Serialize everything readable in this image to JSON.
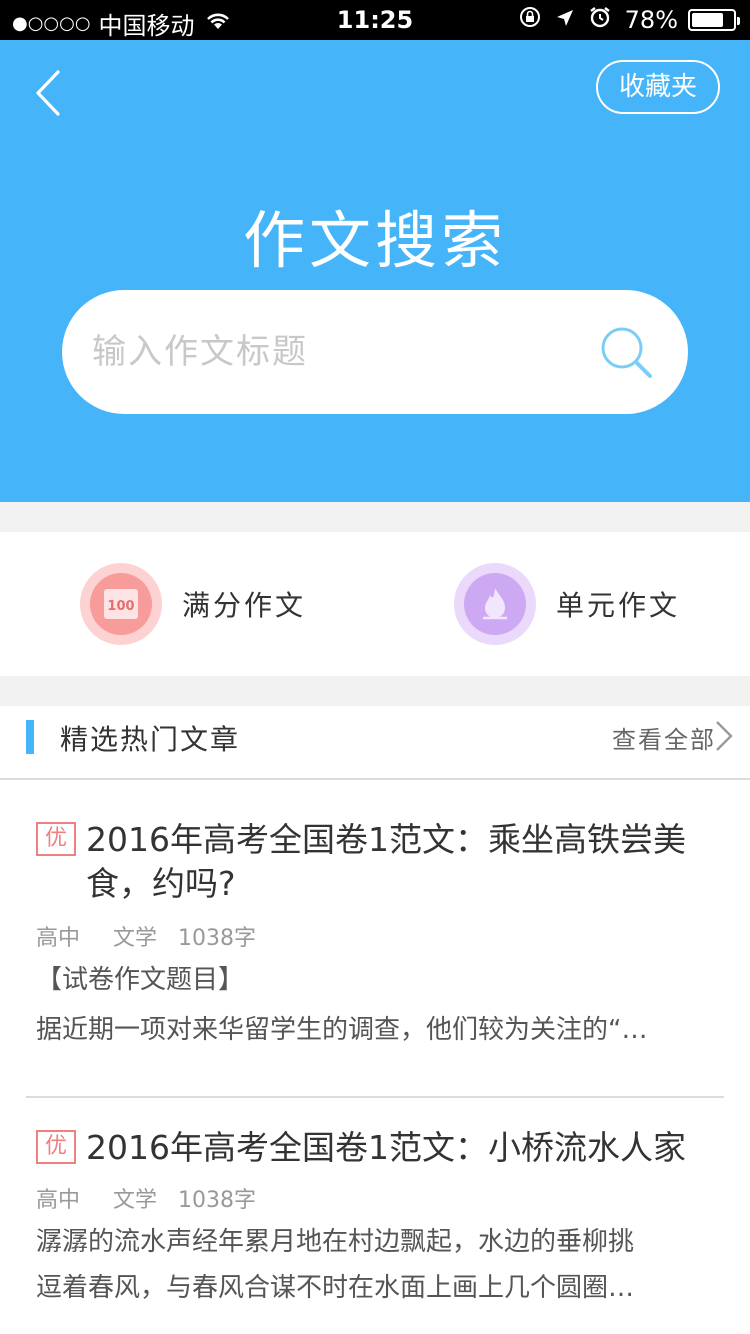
{
  "status_bar": {
    "signal_dots": "●○○○○",
    "carrier": "中国移动",
    "time": "11:25",
    "battery": "78%",
    "battery_level": 0.78,
    "wifi_icon": "wifi-icon",
    "lock_icon": "rotation-lock-icon",
    "location_icon": "location-arrow-icon",
    "alarm_icon": "alarm-icon"
  },
  "header": {
    "favorites_label": "收藏夹",
    "title": "作文搜索",
    "search_placeholder": "输入作文标题",
    "background_color": "#46b4f8"
  },
  "quick_links": [
    {
      "label": "满分作文",
      "icon": "score-100-icon",
      "color": "#f48e8e"
    },
    {
      "label": "单元作文",
      "icon": "flame-icon",
      "color": "#c79ef0"
    }
  ],
  "section": {
    "title": "精选热门文章",
    "more_label": "查看全部"
  },
  "articles": [
    {
      "tag": "优",
      "title": "2016年高考全国卷1范文：乘坐高铁尝美食，约吗?",
      "level": "高中",
      "category": "文学",
      "word_count": "1038字",
      "excerpt_line1": "【试卷作文题目】",
      "excerpt_line2": "据近期一项对来华留学生的调查，他们较为关注的“…"
    },
    {
      "tag": "优",
      "title": "2016年高考全国卷1范文：小桥流水人家",
      "level": "高中",
      "category": "文学",
      "word_count": "1038字",
      "excerpt_line1": "潺潺的流水声经年累月地在村边飘起，水边的垂柳挑",
      "excerpt_line2": "逗着春风，与春风合谋不时在水面上画上几个圆圈…"
    }
  ]
}
